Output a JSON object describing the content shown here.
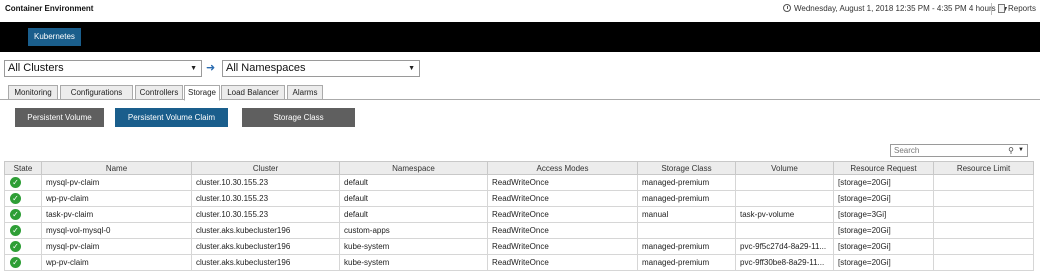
{
  "header": {
    "title": "Container Environment",
    "time_range": "Wednesday, August 1, 2018 12:35 PM - 4:35 PM 4 hours",
    "reports_label": "Reports"
  },
  "nav": {
    "kubernetes_label": "Kubernetes"
  },
  "filters": {
    "cluster_value": "All Clusters",
    "namespace_value": "All Namespaces"
  },
  "tabs": [
    {
      "label": "Monitoring",
      "active": false
    },
    {
      "label": "Configurations",
      "active": false
    },
    {
      "label": "Controllers",
      "active": false
    },
    {
      "label": "Storage",
      "active": true
    },
    {
      "label": "Load Balancer",
      "active": false
    },
    {
      "label": "Alarms",
      "active": false
    }
  ],
  "storage_views": {
    "pv_label": "Persistent Volume",
    "pvc_label": "Persistent Volume Claim",
    "sc_label": "Storage Class",
    "active": "Persistent Volume Claim"
  },
  "search": {
    "placeholder": "Search"
  },
  "colors": {
    "accent": "#1a5e8c",
    "inactive_button": "#5f5f5f",
    "ok": "#2e9e36"
  },
  "table": {
    "columns": [
      "State",
      "Name",
      "Cluster",
      "Namespace",
      "Access Modes",
      "Storage Class",
      "Volume",
      "Resource Request",
      "Resource Limit"
    ],
    "rows": [
      {
        "state": "ok",
        "name": "mysql-pv-claim",
        "cluster": "cluster.10.30.155.23",
        "namespace": "default",
        "access": "ReadWriteOnce",
        "storage_class": "managed-premium",
        "volume": "",
        "request": "[storage=20Gi]",
        "limit": ""
      },
      {
        "state": "ok",
        "name": "wp-pv-claim",
        "cluster": "cluster.10.30.155.23",
        "namespace": "default",
        "access": "ReadWriteOnce",
        "storage_class": "managed-premium",
        "volume": "",
        "request": "[storage=20Gi]",
        "limit": ""
      },
      {
        "state": "ok",
        "name": "task-pv-claim",
        "cluster": "cluster.10.30.155.23",
        "namespace": "default",
        "access": "ReadWriteOnce",
        "storage_class": "manual",
        "volume": "task-pv-volume",
        "request": "[storage=3Gi]",
        "limit": ""
      },
      {
        "state": "ok",
        "name": "mysql-vol-mysql-0",
        "cluster": "cluster.aks.kubecluster196",
        "namespace": "custom-apps",
        "access": "ReadWriteOnce",
        "storage_class": "",
        "volume": "",
        "request": "[storage=20Gi]",
        "limit": ""
      },
      {
        "state": "ok",
        "name": "mysql-pv-claim",
        "cluster": "cluster.aks.kubecluster196",
        "namespace": "kube-system",
        "access": "ReadWriteOnce",
        "storage_class": "managed-premium",
        "volume": "pvc-9f5c27d4-8a29-11...",
        "request": "[storage=20Gi]",
        "limit": ""
      },
      {
        "state": "ok",
        "name": "wp-pv-claim",
        "cluster": "cluster.aks.kubecluster196",
        "namespace": "kube-system",
        "access": "ReadWriteOnce",
        "storage_class": "managed-premium",
        "volume": "pvc-9ff30be8-8a29-11...",
        "request": "[storage=20Gi]",
        "limit": ""
      }
    ]
  }
}
